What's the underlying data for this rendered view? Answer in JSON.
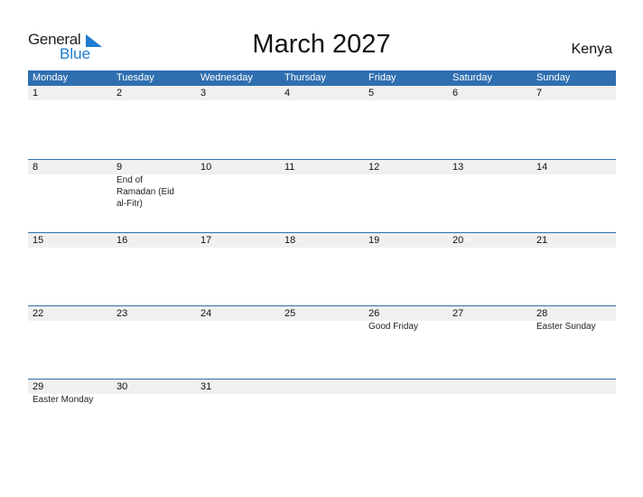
{
  "logo": {
    "word1": "General",
    "word2": "Blue"
  },
  "title": "March 2027",
  "country": "Kenya",
  "colors": {
    "header_bg": "#2f6fb0",
    "accent": "#1e7bd0",
    "strip_bg": "#f0f0f0"
  },
  "weekdays": [
    "Monday",
    "Tuesday",
    "Wednesday",
    "Thursday",
    "Friday",
    "Saturday",
    "Sunday"
  ],
  "weeks": [
    [
      {
        "day": "1",
        "event": ""
      },
      {
        "day": "2",
        "event": ""
      },
      {
        "day": "3",
        "event": ""
      },
      {
        "day": "4",
        "event": ""
      },
      {
        "day": "5",
        "event": ""
      },
      {
        "day": "6",
        "event": ""
      },
      {
        "day": "7",
        "event": ""
      }
    ],
    [
      {
        "day": "8",
        "event": ""
      },
      {
        "day": "9",
        "event": "End of Ramadan (Eid al-Fitr)"
      },
      {
        "day": "10",
        "event": ""
      },
      {
        "day": "11",
        "event": ""
      },
      {
        "day": "12",
        "event": ""
      },
      {
        "day": "13",
        "event": ""
      },
      {
        "day": "14",
        "event": ""
      }
    ],
    [
      {
        "day": "15",
        "event": ""
      },
      {
        "day": "16",
        "event": ""
      },
      {
        "day": "17",
        "event": ""
      },
      {
        "day": "18",
        "event": ""
      },
      {
        "day": "19",
        "event": ""
      },
      {
        "day": "20",
        "event": ""
      },
      {
        "day": "21",
        "event": ""
      }
    ],
    [
      {
        "day": "22",
        "event": ""
      },
      {
        "day": "23",
        "event": ""
      },
      {
        "day": "24",
        "event": ""
      },
      {
        "day": "25",
        "event": ""
      },
      {
        "day": "26",
        "event": "Good Friday"
      },
      {
        "day": "27",
        "event": ""
      },
      {
        "day": "28",
        "event": "Easter Sunday"
      }
    ],
    [
      {
        "day": "29",
        "event": "Easter Monday"
      },
      {
        "day": "30",
        "event": ""
      },
      {
        "day": "31",
        "event": ""
      },
      {
        "day": "",
        "event": ""
      },
      {
        "day": "",
        "event": ""
      },
      {
        "day": "",
        "event": ""
      },
      {
        "day": "",
        "event": ""
      }
    ]
  ]
}
